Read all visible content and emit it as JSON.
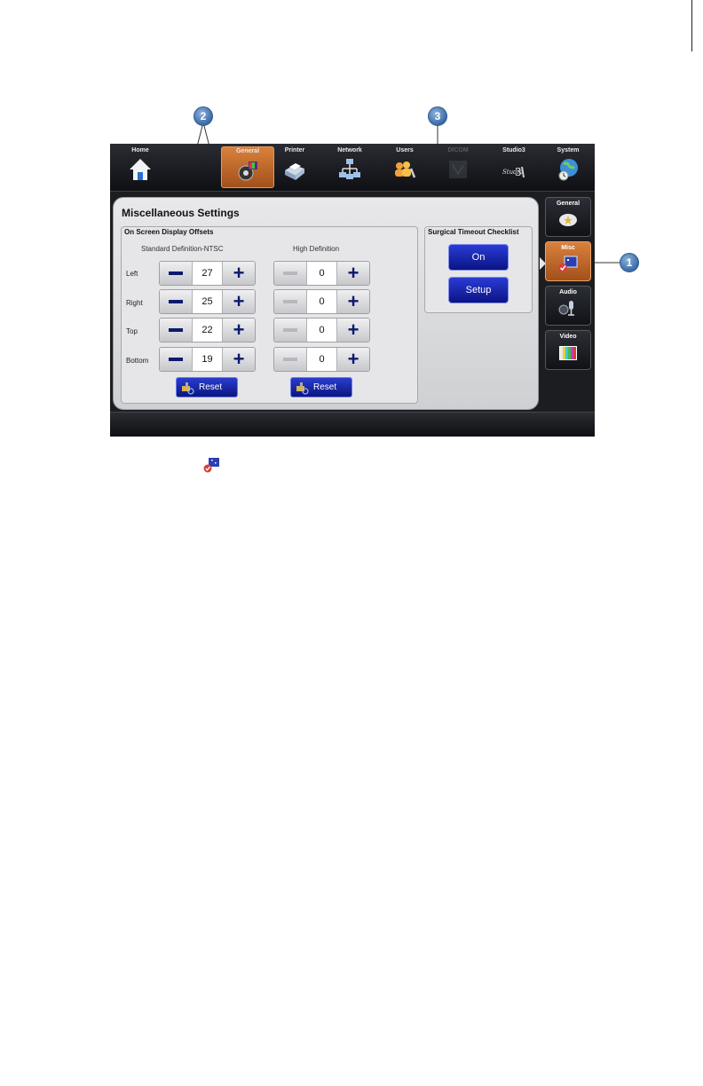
{
  "callouts": {
    "one": "1",
    "two": "2",
    "three": "3"
  },
  "topnav": {
    "items": [
      {
        "label": "Home"
      },
      {
        "label": "General"
      },
      {
        "label": "Printer"
      },
      {
        "label": "Network"
      },
      {
        "label": "Users"
      },
      {
        "label": "DICOM"
      },
      {
        "label": "Studio3"
      },
      {
        "label": "System"
      }
    ],
    "active": "General",
    "disabled": "DICOM"
  },
  "panel": {
    "title": "Miscellaneous Settings",
    "osd": {
      "title": "On Screen Display Offsets",
      "sd_header": "Standard Definition-NTSC",
      "hd_header": "High Definition",
      "rows": [
        {
          "label": "Left",
          "sd": "27",
          "hd": "0"
        },
        {
          "label": "Right",
          "sd": "25",
          "hd": "0"
        },
        {
          "label": "Top",
          "sd": "22",
          "hd": "0"
        },
        {
          "label": "Bottom",
          "sd": "19",
          "hd": "0"
        }
      ],
      "reset_label": "Reset"
    },
    "surgical": {
      "title": "Surgical Timeout Checklist",
      "on_label": "On",
      "setup_label": "Setup"
    }
  },
  "sidetabs": [
    {
      "label": "General"
    },
    {
      "label": "Misc"
    },
    {
      "label": "Audio"
    },
    {
      "label": "Video"
    }
  ],
  "colors": {
    "accent_orange": "#c2692b",
    "button_blue": "#1426b0",
    "stepper_glyph": "#0c1a6b"
  }
}
